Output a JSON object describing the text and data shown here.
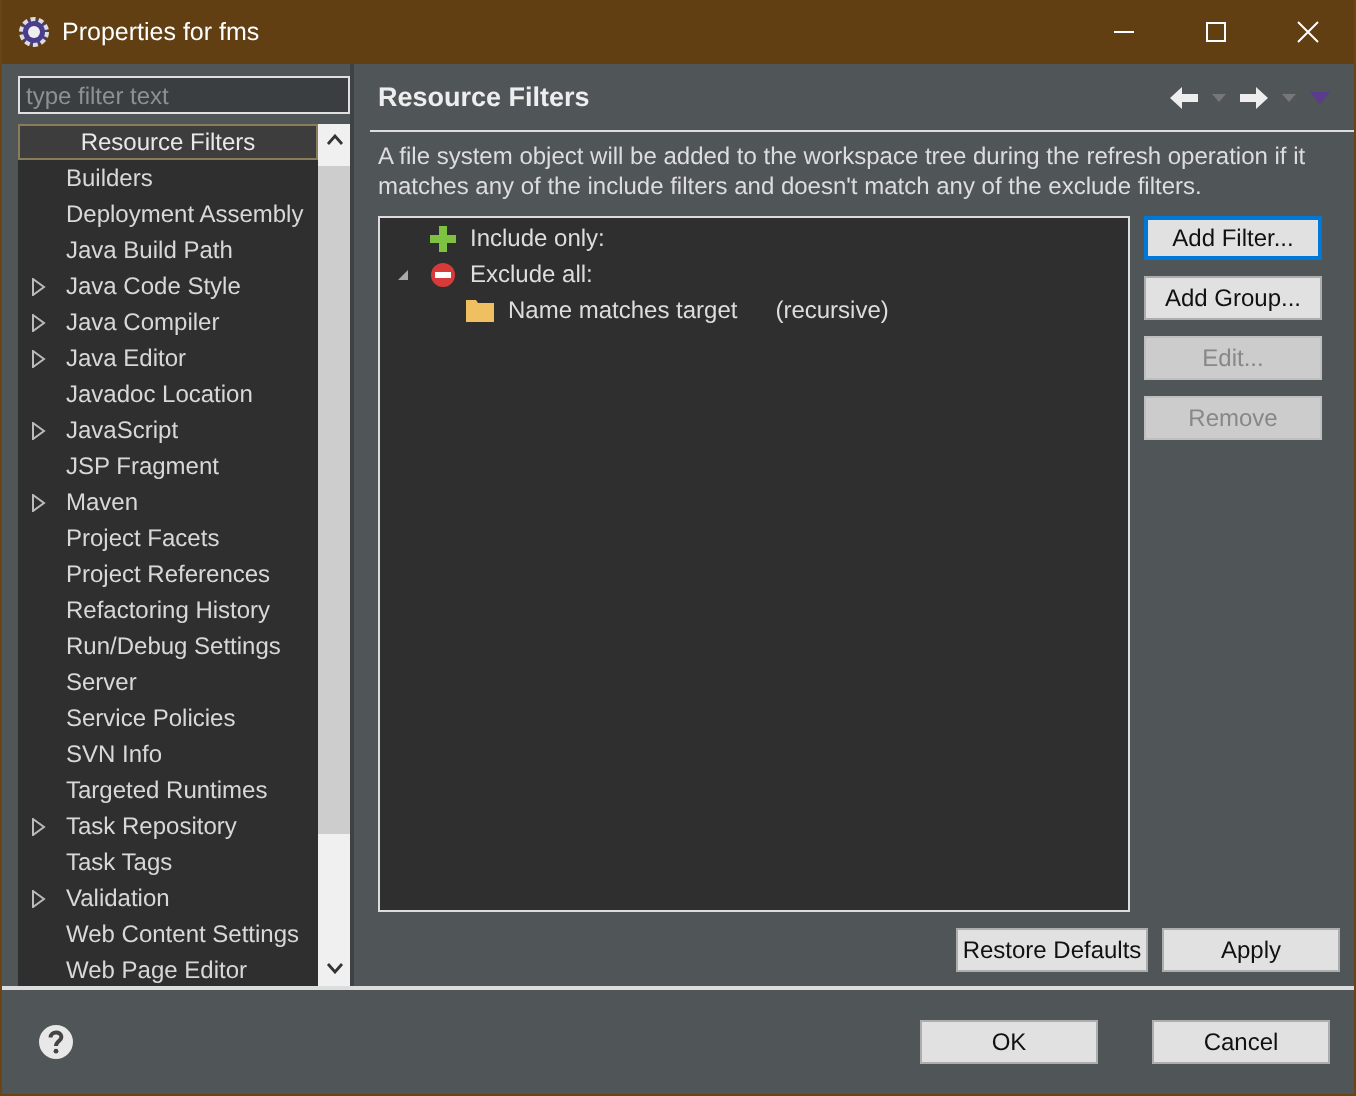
{
  "window": {
    "title": "Properties for fms"
  },
  "filter": {
    "placeholder": "type filter text"
  },
  "nav": [
    {
      "label": "Resource Filters",
      "expandable": false,
      "selected": true
    },
    {
      "label": "Builders",
      "expandable": false,
      "selected": false
    },
    {
      "label": "Deployment Assembly",
      "expandable": false,
      "selected": false
    },
    {
      "label": "Java Build Path",
      "expandable": false,
      "selected": false
    },
    {
      "label": "Java Code Style",
      "expandable": true,
      "selected": false
    },
    {
      "label": "Java Compiler",
      "expandable": true,
      "selected": false
    },
    {
      "label": "Java Editor",
      "expandable": true,
      "selected": false
    },
    {
      "label": "Javadoc Location",
      "expandable": false,
      "selected": false
    },
    {
      "label": "JavaScript",
      "expandable": true,
      "selected": false
    },
    {
      "label": "JSP Fragment",
      "expandable": false,
      "selected": false
    },
    {
      "label": "Maven",
      "expandable": true,
      "selected": false
    },
    {
      "label": "Project Facets",
      "expandable": false,
      "selected": false
    },
    {
      "label": "Project References",
      "expandable": false,
      "selected": false
    },
    {
      "label": "Refactoring History",
      "expandable": false,
      "selected": false
    },
    {
      "label": "Run/Debug Settings",
      "expandable": false,
      "selected": false
    },
    {
      "label": "Server",
      "expandable": false,
      "selected": false
    },
    {
      "label": "Service Policies",
      "expandable": false,
      "selected": false
    },
    {
      "label": "SVN Info",
      "expandable": false,
      "selected": false
    },
    {
      "label": "Targeted Runtimes",
      "expandable": false,
      "selected": false
    },
    {
      "label": "Task Repository",
      "expandable": true,
      "selected": false
    },
    {
      "label": "Task Tags",
      "expandable": false,
      "selected": false
    },
    {
      "label": "Validation",
      "expandable": true,
      "selected": false
    },
    {
      "label": "Web Content Settings",
      "expandable": false,
      "selected": false
    },
    {
      "label": "Web Page Editor",
      "expandable": false,
      "selected": false
    }
  ],
  "page": {
    "title": "Resource Filters",
    "description": "A file system object will be added to the workspace tree during the refresh operation if it matches any of the include filters and doesn't match any of the exclude filters.",
    "tree": [
      {
        "kind": "include",
        "label": "Include only:"
      },
      {
        "kind": "exclude",
        "label": "Exclude all:",
        "expanded": true,
        "children": [
          {
            "kind": "folder",
            "label": "Name matches target",
            "detail": "(recursive)"
          }
        ]
      }
    ],
    "side_buttons": [
      {
        "label": "Add Filter...",
        "disabled": false,
        "default": true
      },
      {
        "label": "Add Group...",
        "disabled": false,
        "default": false
      },
      {
        "label": "Edit...",
        "disabled": true,
        "default": false
      },
      {
        "label": "Remove",
        "disabled": true,
        "default": false
      }
    ],
    "page_buttons": [
      "Restore Defaults",
      "Apply"
    ]
  },
  "dialog_buttons": [
    "OK",
    "Cancel"
  ]
}
